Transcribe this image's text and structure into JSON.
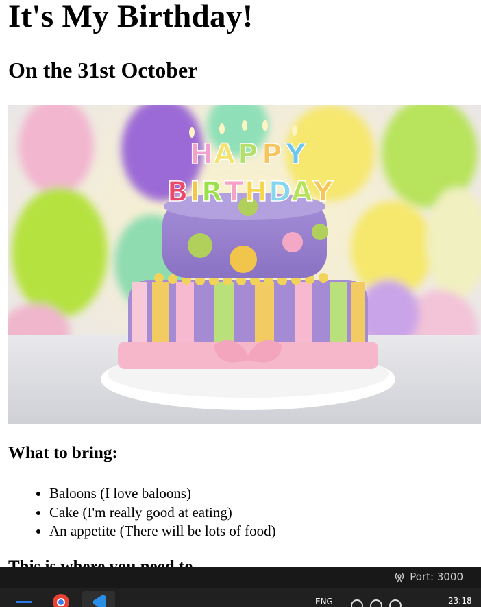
{
  "page": {
    "title": "It's My Birthday!",
    "subtitle": "On the 31st October",
    "image": {
      "description_icon": "birthday-cake-image"
    },
    "bring_heading": "What to bring:",
    "bring_items": [
      "Baloons (I love baloons)",
      "Cake (I'm really good at eating)",
      "An appetite (There will be lots of food)"
    ],
    "partial_heading": "This is where you need to..."
  },
  "statusbar": {
    "port_label": "Port: 3000",
    "port_icon": "broadcast-icon"
  },
  "taskbar": {
    "language": "ENG",
    "time": "23:18",
    "apps": [
      "start-icon",
      "chrome-icon",
      "vscode-icon"
    ]
  }
}
